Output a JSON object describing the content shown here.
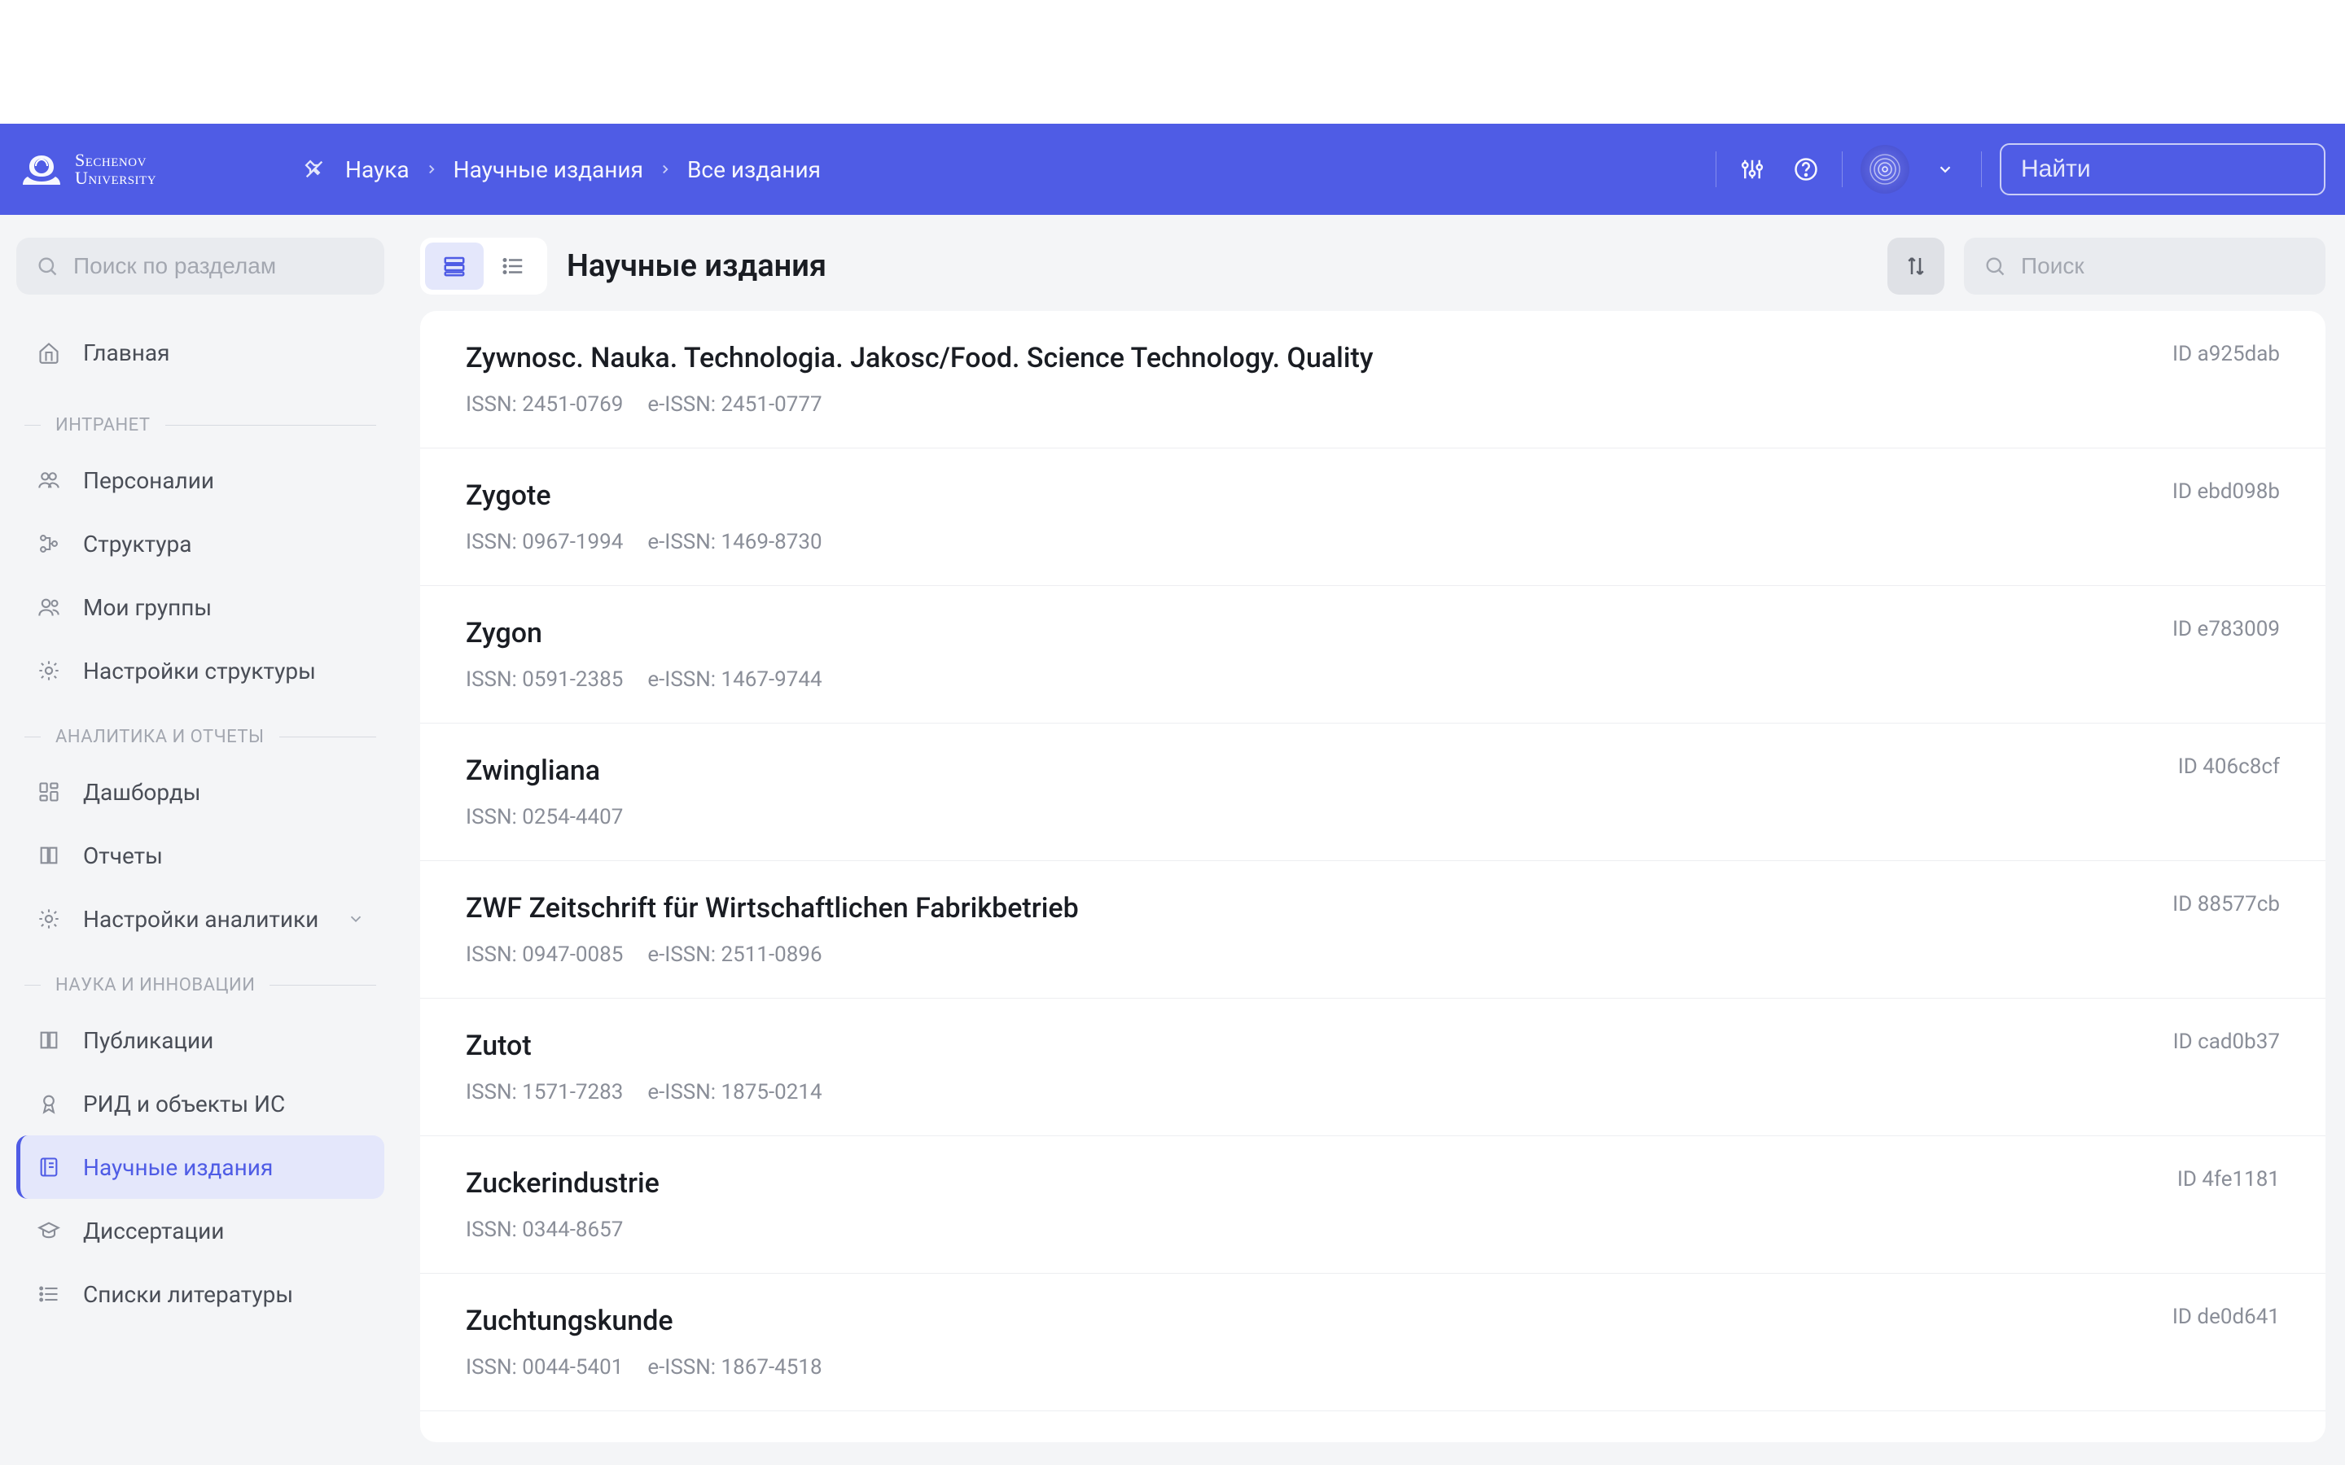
{
  "header": {
    "logo": {
      "line1": "Sechenov",
      "line2": "University"
    },
    "breadcrumb": [
      "Наука",
      "Научные издания",
      "Все издания"
    ],
    "search_placeholder": "Найти"
  },
  "sidebar": {
    "search_placeholder": "Поиск по разделам",
    "home": "Главная",
    "sections": [
      {
        "title": "ИНТРАНЕТ",
        "items": [
          {
            "id": "personnel",
            "label": "Персоналии",
            "icon": "people"
          },
          {
            "id": "structure",
            "label": "Структура",
            "icon": "tree"
          },
          {
            "id": "mygroups",
            "label": "Мои группы",
            "icon": "people2"
          },
          {
            "id": "struct-settings",
            "label": "Настройки структуры",
            "icon": "gear"
          }
        ]
      },
      {
        "title": "АНАЛИТИКА И ОТЧЕТЫ",
        "items": [
          {
            "id": "dashboards",
            "label": "Дашборды",
            "icon": "dashboard"
          },
          {
            "id": "reports",
            "label": "Отчеты",
            "icon": "book"
          },
          {
            "id": "analytics-settings",
            "label": "Настройки аналитики",
            "icon": "gear",
            "expandable": true
          }
        ]
      },
      {
        "title": "НАУКА И ИННОВАЦИИ",
        "items": [
          {
            "id": "publications",
            "label": "Публикации",
            "icon": "book"
          },
          {
            "id": "rid",
            "label": "РИД и объекты ИС",
            "icon": "award"
          },
          {
            "id": "journals",
            "label": "Научные издания",
            "icon": "journal",
            "active": true
          },
          {
            "id": "dissertations",
            "label": "Диссертации",
            "icon": "graduation"
          },
          {
            "id": "references",
            "label": "Списки литературы",
            "icon": "list"
          }
        ]
      }
    ]
  },
  "main": {
    "title": "Научные издания",
    "search_placeholder": "Поиск",
    "id_label": "ID",
    "issn_label": "ISSN:",
    "eissn_label": "e-ISSN:",
    "items": [
      {
        "title": "Zywnosc. Nauka. Technologia. Jakosc/Food. Science Technology. Quality",
        "issn": "2451-0769",
        "eissn": "2451-0777",
        "id": "a925dab"
      },
      {
        "title": "Zygote",
        "issn": "0967-1994",
        "eissn": "1469-8730",
        "id": "ebd098b"
      },
      {
        "title": "Zygon",
        "issn": "0591-2385",
        "eissn": "1467-9744",
        "id": "e783009"
      },
      {
        "title": "Zwingliana",
        "issn": "0254-4407",
        "eissn": null,
        "id": "406c8cf"
      },
      {
        "title": "ZWF Zeitschrift für Wirtschaftlichen Fabrikbetrieb",
        "issn": "0947-0085",
        "eissn": "2511-0896",
        "id": "88577cb"
      },
      {
        "title": "Zutot",
        "issn": "1571-7283",
        "eissn": "1875-0214",
        "id": "cad0b37"
      },
      {
        "title": "Zuckerindustrie",
        "issn": "0344-8657",
        "eissn": null,
        "id": "4fe1181"
      },
      {
        "title": "Zuchtungskunde",
        "issn": "0044-5401",
        "eissn": "1867-4518",
        "id": "de0d641"
      }
    ]
  }
}
